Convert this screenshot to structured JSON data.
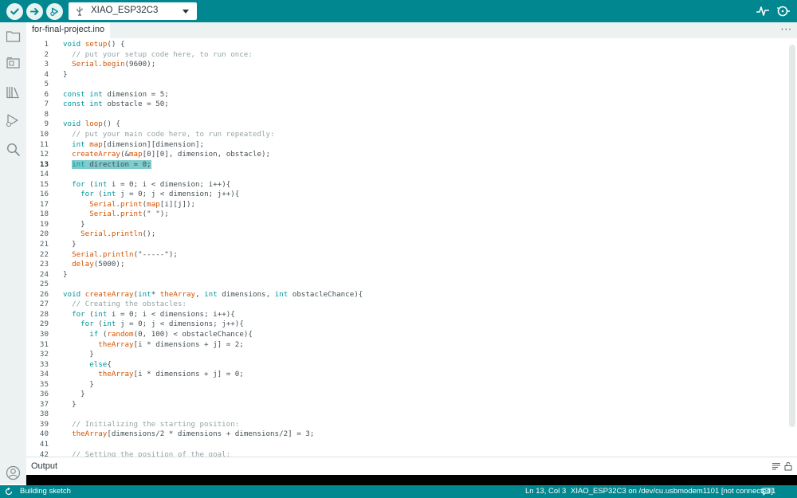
{
  "toolbar": {
    "verify_icon": "checkmark-icon",
    "upload_icon": "arrow-right-icon",
    "debug_icon": "debug-icon",
    "board_name": "XIAO_ESP32C3",
    "serial_plotter_icon": "serial-plotter-icon",
    "serial_monitor_icon": "serial-monitor-icon"
  },
  "sidebar": {
    "items": [
      "folder-icon",
      "boards-icon",
      "library-icon",
      "debug-run-icon",
      "search-icon"
    ],
    "profile_icon": "account-icon"
  },
  "tab": {
    "label": "for-final-project.ino",
    "more": "···"
  },
  "editor": {
    "active_line": 13,
    "lines": [
      {
        "n": "1",
        "text": "void setup() {"
      },
      {
        "n": "2",
        "text": "  // put your setup code here, to run once:"
      },
      {
        "n": "3",
        "text": "  Serial.begin(9600);"
      },
      {
        "n": "4",
        "text": "}"
      },
      {
        "n": "5",
        "text": ""
      },
      {
        "n": "6",
        "text": "const int dimension = 5;"
      },
      {
        "n": "7",
        "text": "const int obstacle = 50;"
      },
      {
        "n": "8",
        "text": ""
      },
      {
        "n": "9",
        "text": "void loop() {"
      },
      {
        "n": "10",
        "text": "  // put your main code here, to run repeatedly:"
      },
      {
        "n": "11",
        "text": "  int map[dimension][dimension];"
      },
      {
        "n": "12",
        "text": "  createArray(&map[0][0], dimension, obstacle);"
      },
      {
        "n": "13",
        "text": "  int direction = 0;"
      },
      {
        "n": "14",
        "text": ""
      },
      {
        "n": "15",
        "text": "  for (int i = 0; i < dimension; i++){"
      },
      {
        "n": "16",
        "text": "    for (int j = 0; j < dimension; j++){"
      },
      {
        "n": "17",
        "text": "      Serial.print(map[i][j]);"
      },
      {
        "n": "18",
        "text": "      Serial.print(\" \");"
      },
      {
        "n": "19",
        "text": "    }"
      },
      {
        "n": "20",
        "text": "    Serial.println();"
      },
      {
        "n": "21",
        "text": "  }"
      },
      {
        "n": "22",
        "text": "  Serial.println(\"-----\");"
      },
      {
        "n": "23",
        "text": "  delay(5000);"
      },
      {
        "n": "24",
        "text": "}"
      },
      {
        "n": "25",
        "text": ""
      },
      {
        "n": "26",
        "text": "void createArray(int* theArray, int dimensions, int obstacleChance){"
      },
      {
        "n": "27",
        "text": "  // Creating the obstacles:"
      },
      {
        "n": "28",
        "text": "  for (int i = 0; i < dimensions; i++){"
      },
      {
        "n": "29",
        "text": "    for (int j = 0; j < dimensions; j++){"
      },
      {
        "n": "30",
        "text": "      if (random(0, 100) < obstacleChance){"
      },
      {
        "n": "31",
        "text": "        theArray[i * dimensions + j] = 2;"
      },
      {
        "n": "32",
        "text": "      }"
      },
      {
        "n": "33",
        "text": "      else{"
      },
      {
        "n": "34",
        "text": "        theArray[i * dimensions + j] = 0;"
      },
      {
        "n": "35",
        "text": "      }"
      },
      {
        "n": "36",
        "text": "    }"
      },
      {
        "n": "37",
        "text": "  }"
      },
      {
        "n": "38",
        "text": ""
      },
      {
        "n": "39",
        "text": "  // Initializing the starting position:"
      },
      {
        "n": "40",
        "text": "  theArray[dimensions/2 * dimensions + dimensions/2] = 3;"
      },
      {
        "n": "41",
        "text": ""
      },
      {
        "n": "42",
        "text": "  // Setting the position of the goal:"
      }
    ]
  },
  "output": {
    "title": "Output",
    "clear_icon": "clear-output-icon",
    "lock_icon": "scroll-lock-icon"
  },
  "status": {
    "task": "Building sketch",
    "position": "Ln 13, Col 3",
    "connection": "XIAO_ESP32C3 on /dev/cu.usbmodem1101 [not connected]",
    "notifications": "1"
  },
  "colors": {
    "accent": "#00878f",
    "keyword": "#00979c",
    "function": "#d35400",
    "comment": "#95a5a6",
    "highlight": "#7fcbcd"
  }
}
